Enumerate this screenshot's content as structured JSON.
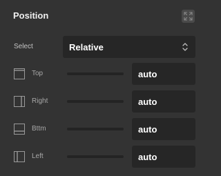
{
  "panel": {
    "title": "Position",
    "expand_icon": "expand-arrows-icon"
  },
  "select": {
    "label": "Select",
    "value": "Relative",
    "icon": "chevron-up-down-icon"
  },
  "offsets": [
    {
      "label": "Top",
      "value": "auto",
      "icon": "border-top-icon"
    },
    {
      "label": "Right",
      "value": "auto",
      "icon": "border-right-icon"
    },
    {
      "label": "Bttm",
      "value": "auto",
      "icon": "border-bottom-icon"
    },
    {
      "label": "Left",
      "value": "auto",
      "icon": "border-left-icon"
    }
  ],
  "colors": {
    "panel_bg": "#333333",
    "field_bg": "#262626",
    "text_primary": "#ffffff",
    "text_secondary": "#a8a8a8"
  }
}
